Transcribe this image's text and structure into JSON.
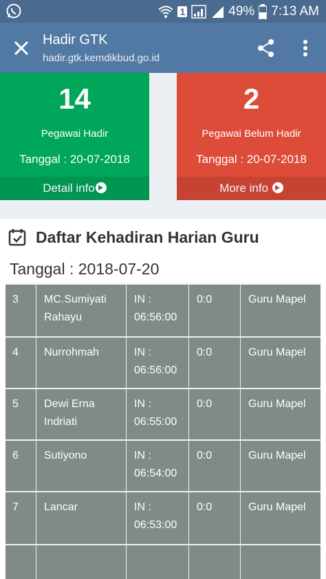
{
  "status_bar": {
    "battery": "49%",
    "time": "7:13 AM",
    "sim_badge": "1"
  },
  "appbar": {
    "title": "Hadir GTK",
    "url": "hadir.gtk.kemdikbud.go.id"
  },
  "stats": [
    {
      "count": "14",
      "label": "Pegawai Hadir",
      "date": "Tanggal : 20-07-2018",
      "link": "Detail info"
    },
    {
      "count": "2",
      "label": "Pegawai Belum Hadir",
      "date": "Tanggal : 20-07-2018",
      "link": "More info"
    }
  ],
  "panel": {
    "title": "Daftar Kehadiran Harian Guru",
    "date": "Tanggal : 2018-07-20"
  },
  "rows": [
    {
      "no": "3",
      "name": "MC.Sumiyati Rahayu",
      "in": "IN : 06:56:00",
      "late": "0:0",
      "role": "Guru Mapel"
    },
    {
      "no": "4",
      "name": "Nurrohmah",
      "in": "IN : 06:56:00",
      "late": "0:0",
      "role": "Guru Mapel"
    },
    {
      "no": "5",
      "name": "Dewi Erna Indriati",
      "in": "IN : 06:55:00",
      "late": "0:0",
      "role": "Guru Mapel"
    },
    {
      "no": "6",
      "name": "Sutiyono",
      "in": "IN : 06:54:00",
      "late": "0:0",
      "role": "Guru Mapel"
    },
    {
      "no": "7",
      "name": "Lancar",
      "in": "IN : 06:53:00",
      "late": "0:0",
      "role": "Guru Mapel"
    }
  ],
  "colors": {
    "appbar": "#5279a4",
    "success": "#00a65a",
    "danger": "#dd4b39",
    "table_bg": "#7f8a89"
  }
}
